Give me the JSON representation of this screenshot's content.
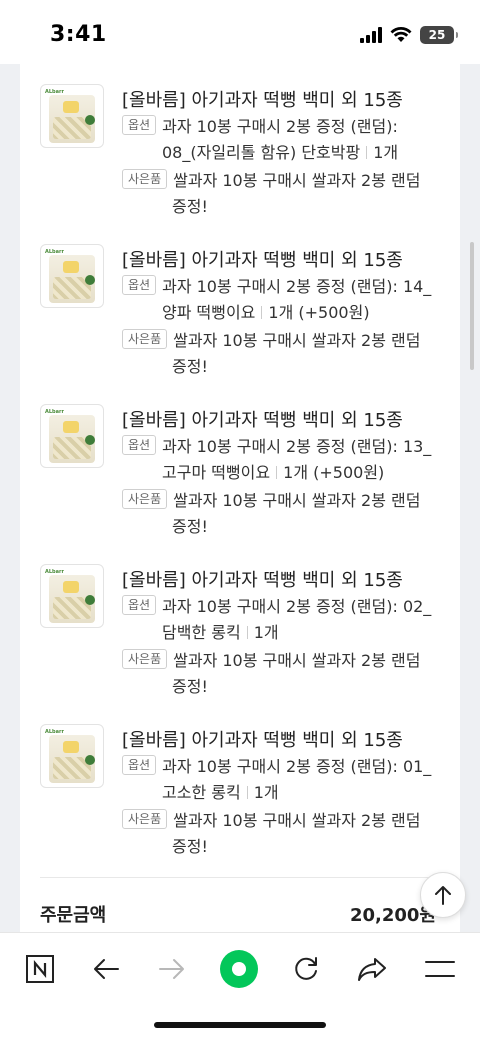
{
  "status": {
    "time": "3:41",
    "battery": "25"
  },
  "items": [
    {
      "title": "[올바름] 아기과자 떡뻥 백미 외 15종",
      "option_tag": "옵션",
      "option_line1": "과자 10봉 구매시 2봉 증정 (랜덤):",
      "option_line2": "08_(자일리톨 함유) 단호박팡",
      "qty": "1개",
      "extra": "",
      "gift_tag": "사은품",
      "gift_line1": "쌀과자 10봉 구매시 쌀과자 2봉 랜덤",
      "gift_line2": "증정!"
    },
    {
      "title": "[올바름] 아기과자 떡뻥 백미 외 15종",
      "option_tag": "옵션",
      "option_line1": "과자 10봉 구매시 2봉 증정 (랜덤): 14_",
      "option_line2": "양파 떡뻥이요",
      "qty": "1개",
      "extra": "(+500원)",
      "gift_tag": "사은품",
      "gift_line1": "쌀과자 10봉 구매시 쌀과자 2봉 랜덤",
      "gift_line2": "증정!"
    },
    {
      "title": "[올바름] 아기과자 떡뻥 백미 외 15종",
      "option_tag": "옵션",
      "option_line1": "과자 10봉 구매시 2봉 증정 (랜덤): 13_",
      "option_line2": "고구마 떡뻥이요",
      "qty": "1개",
      "extra": "(+500원)",
      "gift_tag": "사은품",
      "gift_line1": "쌀과자 10봉 구매시 쌀과자 2봉 랜덤",
      "gift_line2": "증정!"
    },
    {
      "title": "[올바름] 아기과자 떡뻥 백미 외 15종",
      "option_tag": "옵션",
      "option_line1": "과자 10봉 구매시 2봉 증정 (랜덤): 02_",
      "option_line2": "담백한 롱킥",
      "qty": "1개",
      "extra": "",
      "gift_tag": "사은품",
      "gift_line1": "쌀과자 10봉 구매시 쌀과자 2봉 랜덤",
      "gift_line2": "증정!"
    },
    {
      "title": "[올바름] 아기과자 떡뻥 백미 외 15종",
      "option_tag": "옵션",
      "option_line1": "과자 10봉 구매시 2봉 증정 (랜덤): 01_",
      "option_line2": "고소한 롱킥",
      "qty": "1개",
      "extra": "",
      "gift_tag": "사은품",
      "gift_line1": "쌀과자 10봉 구매시 쌀과자 2봉 랜덤",
      "gift_line2": "증정!"
    }
  ],
  "thumb_brand": "ALbarr",
  "summary": {
    "label": "주문금액",
    "value": "20,200원"
  },
  "icons": {
    "naver": "naver-icon",
    "back": "back-arrow-icon",
    "forward": "forward-arrow-icon",
    "home": "green-circle-icon",
    "reload": "reload-icon",
    "share": "share-icon",
    "menu": "menu-icon",
    "scroll_top": "arrow-up-icon"
  },
  "colors": {
    "accent_green": "#03c75a",
    "text": "#222222",
    "tag_border": "#cfcfcf"
  }
}
